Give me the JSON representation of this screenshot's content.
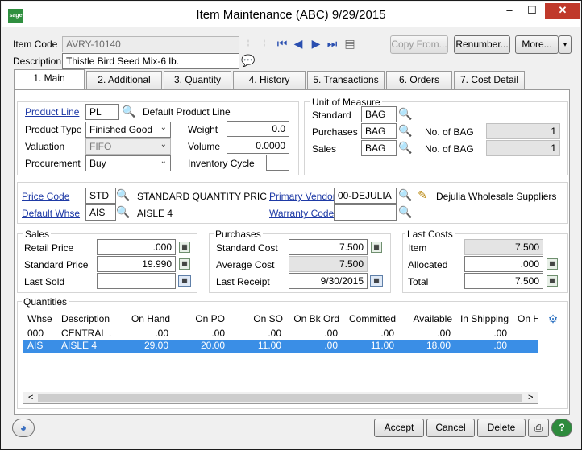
{
  "window": {
    "title": "Item Maintenance (ABC) 9/29/2015",
    "logo": "sage",
    "minimize": "–",
    "maximize": "☐",
    "close": "✕"
  },
  "header": {
    "item_code_label": "Item Code",
    "item_code_value": "AVRY-10140",
    "description_label": "Description",
    "description_value": "Thistle Bird Seed Mix-6 lb.",
    "copy_from": "Copy From...",
    "renumber": "Renumber...",
    "more": "More...",
    "more_arrow": "▾"
  },
  "tabs": [
    {
      "label": "1. Main"
    },
    {
      "label": "2. Additional"
    },
    {
      "label": "3. Quantity"
    },
    {
      "label": "4. History"
    },
    {
      "label": "5. Transactions"
    },
    {
      "label": "6. Orders"
    },
    {
      "label": "7. Cost Detail"
    }
  ],
  "main": {
    "product_line_label": "Product Line",
    "product_line_value": "PL",
    "product_line_desc": "Default Product Line",
    "product_type_label": "Product Type",
    "product_type_value": "Finished Good",
    "valuation_label": "Valuation",
    "valuation_value": "FIFO",
    "procurement_label": "Procurement",
    "procurement_value": "Buy",
    "weight_label": "Weight",
    "weight_value": "0.0",
    "volume_label": "Volume",
    "volume_value": "0.0000",
    "inventory_cycle_label": "Inventory Cycle",
    "inventory_cycle_value": ""
  },
  "uom": {
    "title": "Unit of Measure",
    "standard_label": "Standard",
    "standard_value": "BAG",
    "purchases_label": "Purchases",
    "purchases_value": "BAG",
    "sales_label": "Sales",
    "sales_value": "BAG",
    "no_of_bag_label": "No. of  BAG",
    "purchases_qty": "1",
    "sales_qty": "1"
  },
  "codes": {
    "price_code_label": "Price Code",
    "price_code_value": "STD",
    "price_code_desc": "STANDARD QUANTITY PRIC",
    "default_whse_label": "Default Whse",
    "default_whse_value": "AIS",
    "default_whse_desc": "AISLE 4",
    "primary_vendor_label": "Primary Vendor",
    "primary_vendor_value": "00-DEJULIA",
    "primary_vendor_desc": "Dejulia Wholesale Suppliers",
    "warranty_code_label": "Warranty Code",
    "warranty_code_value": ""
  },
  "sales": {
    "title": "Sales",
    "retail_price_label": "Retail Price",
    "retail_price_value": ".000",
    "standard_price_label": "Standard Price",
    "standard_price_value": "19.990",
    "last_sold_label": "Last Sold",
    "last_sold_value": ""
  },
  "purchases": {
    "title": "Purchases",
    "standard_cost_label": "Standard Cost",
    "standard_cost_value": "7.500",
    "average_cost_label": "Average Cost",
    "average_cost_value": "7.500",
    "last_receipt_label": "Last Receipt",
    "last_receipt_value": "9/30/2015"
  },
  "last_costs": {
    "title": "Last Costs",
    "item_label": "Item",
    "item_value": "7.500",
    "allocated_label": "Allocated",
    "allocated_value": ".000",
    "total_label": "Total",
    "total_value": "7.500"
  },
  "quantities": {
    "title": "Quantities",
    "columns": [
      "Whse",
      "Description",
      "On Hand",
      "On PO",
      "On SO",
      "On Bk Ord",
      "Committed",
      "Available",
      "In Shipping",
      "On H"
    ],
    "rows": [
      [
        "000",
        "CENTRAL ...",
        ".00",
        ".00",
        ".00",
        ".00",
        ".00",
        ".00",
        ".00"
      ],
      [
        "AIS",
        "AISLE 4",
        "29.00",
        "20.00",
        "11.00",
        ".00",
        "11.00",
        "18.00",
        ".00"
      ]
    ],
    "scroll_left": "<",
    "scroll_right": ">"
  },
  "footer": {
    "accept": "Accept",
    "cancel": "Cancel",
    "delete": "Delete",
    "print_icon": "printer-icon",
    "help": "?"
  },
  "colors": {
    "accent": "#3a8ee6",
    "link": "#1e3aa6",
    "close": "#c0392b",
    "logo": "#2f8f3f"
  }
}
